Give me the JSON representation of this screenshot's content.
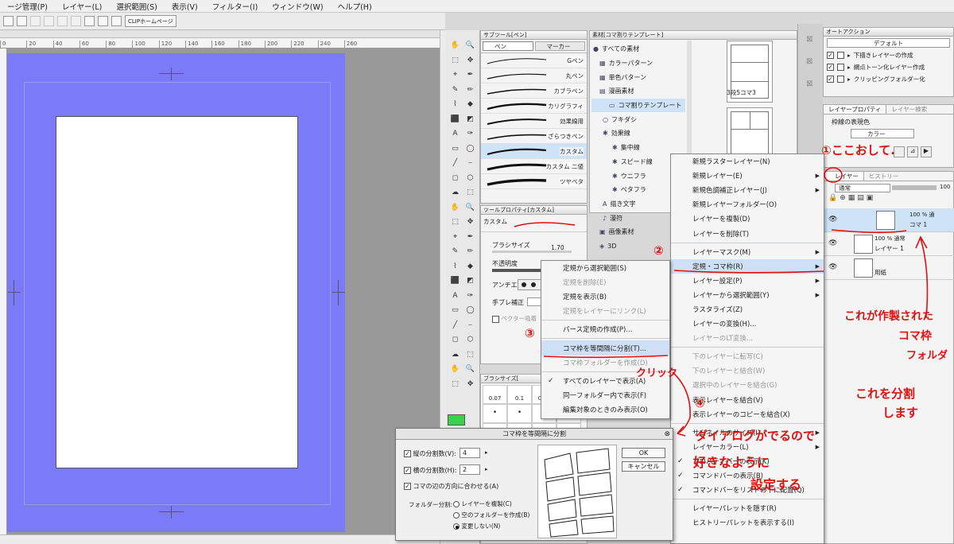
{
  "menubar": [
    "ージ管理(P)",
    "レイヤー(L)",
    "選択範囲(S)",
    "表示(V)",
    "フィルター(I)",
    "ウィンドウ(W)",
    "ヘルプ(H)"
  ],
  "cmdbar": {
    "clip_button": "CLIPホームページ"
  },
  "ruler": [
    "0",
    "20",
    "40",
    "60",
    "80",
    "100",
    "120",
    "140",
    "160",
    "180",
    "200",
    "220",
    "240",
    "260"
  ],
  "subtool": {
    "title": "サブツール[ペン]",
    "tab_pen": "ペン",
    "tab_marker": "マーカー",
    "items": [
      "Gペン",
      "丸ペン",
      "カブラペン",
      "カリグラフィ",
      "効果線用",
      "ざらつきペン",
      "カスタム",
      "カスタム 二値",
      "ツヤベタ"
    ]
  },
  "toolprop": {
    "title": "ツールプロパティ[カスタム]",
    "name": "カスタム",
    "brush_size_label": "ブラシサイズ",
    "brush_size_value": "1.70",
    "opacity_label": "不透明度",
    "antialias_label": "アンチエ",
    "stabilize_label": "手ブレ補正",
    "vector_label": "ベクター吸着"
  },
  "brushsize": {
    "title": "ブラシサイズ[",
    "row1": [
      "0.07",
      "0.1",
      "0.15",
      "0.2"
    ]
  },
  "material": {
    "title": "素材[コマ割りテンプレート]",
    "tree": [
      "すべての素材",
      "カラーパターン",
      "単色パターン",
      "漫画素材",
      "コマ割りテンプレート",
      "フキダシ",
      "効果線",
      "集中線",
      "スピード線",
      "ウニフラ",
      "ベタフラ",
      "描き文字",
      "漫符",
      "画像素材",
      "3D"
    ],
    "thumb_label": "3段5コマ3"
  },
  "autoaction": {
    "title": "オートアクション",
    "set": "デフォルト",
    "items": [
      "下描きレイヤーの作成",
      "網点トーン化レイヤー作成",
      "クリッピングフォルダー化"
    ]
  },
  "layerprop": {
    "tab_prop": "レイヤープロパティ",
    "tab_search": "レイヤー検索",
    "border_label": "枠線の表現色",
    "color_value": "カラー"
  },
  "layerpanel": {
    "tab_layer": "レイヤー",
    "tab_history": "ヒストリー",
    "blend": "通常",
    "opacity": "100",
    "layers": [
      {
        "info": "100 % 通",
        "name": "コマ 1"
      },
      {
        "info": "100 % 通常",
        "name": "レイヤー 1"
      },
      {
        "info": "",
        "name": "用紙"
      }
    ]
  },
  "layer_menu": [
    {
      "label": "新規ラスターレイヤー(N)",
      "arrow": false,
      "dis": false,
      "hl": false
    },
    {
      "label": "新規レイヤー(E)",
      "arrow": true,
      "dis": false,
      "hl": false
    },
    {
      "label": "新規色調補正レイヤー(J)",
      "arrow": true,
      "dis": false,
      "hl": false
    },
    {
      "label": "新規レイヤーフォルダー(O)",
      "arrow": false,
      "dis": false,
      "hl": false
    },
    {
      "label": "レイヤーを複製(D)",
      "arrow": false,
      "dis": false,
      "hl": false
    },
    {
      "label": "レイヤーを削除(T)",
      "arrow": false,
      "dis": false,
      "hl": false
    },
    {
      "sep": true
    },
    {
      "label": "レイヤーマスク(M)",
      "arrow": true,
      "dis": false,
      "hl": false
    },
    {
      "label": "定規・コマ枠(R)",
      "arrow": true,
      "dis": false,
      "hl": true
    },
    {
      "label": "レイヤー設定(P)",
      "arrow": true,
      "dis": false,
      "hl": false
    },
    {
      "label": "レイヤーから選択範囲(Y)",
      "arrow": true,
      "dis": false,
      "hl": false
    },
    {
      "label": "ラスタライズ(Z)",
      "arrow": false,
      "dis": false,
      "hl": false
    },
    {
      "label": "レイヤーの変換(H)...",
      "arrow": false,
      "dis": false,
      "hl": false
    },
    {
      "label": "レイヤーのLT変換...",
      "arrow": false,
      "dis": true,
      "hl": false
    },
    {
      "sep": true
    },
    {
      "label": "下のレイヤーに転写(C)",
      "arrow": false,
      "dis": true,
      "hl": false
    },
    {
      "label": "下のレイヤーと結合(W)",
      "arrow": false,
      "dis": true,
      "hl": false
    },
    {
      "label": "選択中のレイヤーを結合(G)",
      "arrow": false,
      "dis": true,
      "hl": false
    },
    {
      "label": "表示レイヤーを結合(V)",
      "arrow": false,
      "dis": false,
      "hl": false
    },
    {
      "label": "表示レイヤーのコピーを結合(X)",
      "arrow": false,
      "dis": false,
      "hl": false
    },
    {
      "sep": true
    },
    {
      "label": "サムネイルのサイズ(I)",
      "arrow": true,
      "dis": false,
      "hl": false
    },
    {
      "label": "レイヤーカラー(L)",
      "arrow": true,
      "dis": false,
      "hl": false
    },
    {
      "label": "プロパティバーの表示(K)",
      "arrow": false,
      "dis": false,
      "hl": false,
      "check": true
    },
    {
      "label": "コマンドバーの表示(B)",
      "arrow": false,
      "dis": false,
      "hl": false,
      "check": true
    },
    {
      "label": "コマンドバーをリストの下に配置(Q)",
      "arrow": false,
      "dis": false,
      "hl": false,
      "check": true
    },
    {
      "sep": true
    },
    {
      "label": "レイヤーパレットを隠す(R)",
      "arrow": false,
      "dis": false,
      "hl": false
    },
    {
      "label": "ヒストリーパレットを表示する(I)",
      "arrow": false,
      "dis": false,
      "hl": false
    }
  ],
  "sub_menu": [
    {
      "label": "定規から選択範囲(S)",
      "dis": false,
      "hl": false
    },
    {
      "label": "定規を削除(E)",
      "dis": true,
      "hl": false
    },
    {
      "label": "定規を表示(B)",
      "dis": false,
      "hl": false
    },
    {
      "label": "定規をレイヤーにリンク(L)",
      "dis": true,
      "hl": false
    },
    {
      "sep": true
    },
    {
      "label": "パース定規の作成(P)...",
      "dis": false,
      "hl": false
    },
    {
      "sep": true
    },
    {
      "label": "コマ枠を等間隔に分割(T)...",
      "dis": false,
      "hl": true
    },
    {
      "label": "コマ枠フォルダーを作成(D)",
      "dis": true,
      "hl": false
    },
    {
      "sep": true
    },
    {
      "label": "すべてのレイヤーで表示(A)",
      "dis": false,
      "hl": false,
      "check": true
    },
    {
      "label": "同一フォルダー内で表示(F)",
      "dis": false,
      "hl": false
    },
    {
      "label": "編集対象のときのみ表示(O)",
      "dis": false,
      "hl": false
    }
  ],
  "dialog": {
    "title": "コマ枠を等間隔に分割",
    "vdiv_label": "縦の分割数(V):",
    "vdiv_value": "4",
    "hdiv_label": "横の分割数(H):",
    "hdiv_value": "2",
    "align_label": "コマの辺の方向に合わせる(A)",
    "folder_label": "フォルダー分割:",
    "opt1": "レイヤーを複製(C)",
    "opt2": "空のフォルダーを作成(B)",
    "opt3": "変更しない(N)",
    "ok": "OK",
    "cancel": "キャンセル"
  },
  "annotations": {
    "a1": "①ここおして.",
    "a2": "②",
    "a3": "③",
    "a3b": "クリック",
    "a4": "④",
    "a4b": "ダイアログがでるので",
    "a4c": "好きなように",
    "a4d": "設定する",
    "note1": "これが作製された",
    "note2": "コマ枠",
    "note3": "フォルダ",
    "note4": "これを分割",
    "note5": "します"
  },
  "colors": {
    "bleed": "#7b7bfa",
    "highlight": "#cfe0f5",
    "annotation": "#e01010",
    "active_green": "#39d24a"
  }
}
